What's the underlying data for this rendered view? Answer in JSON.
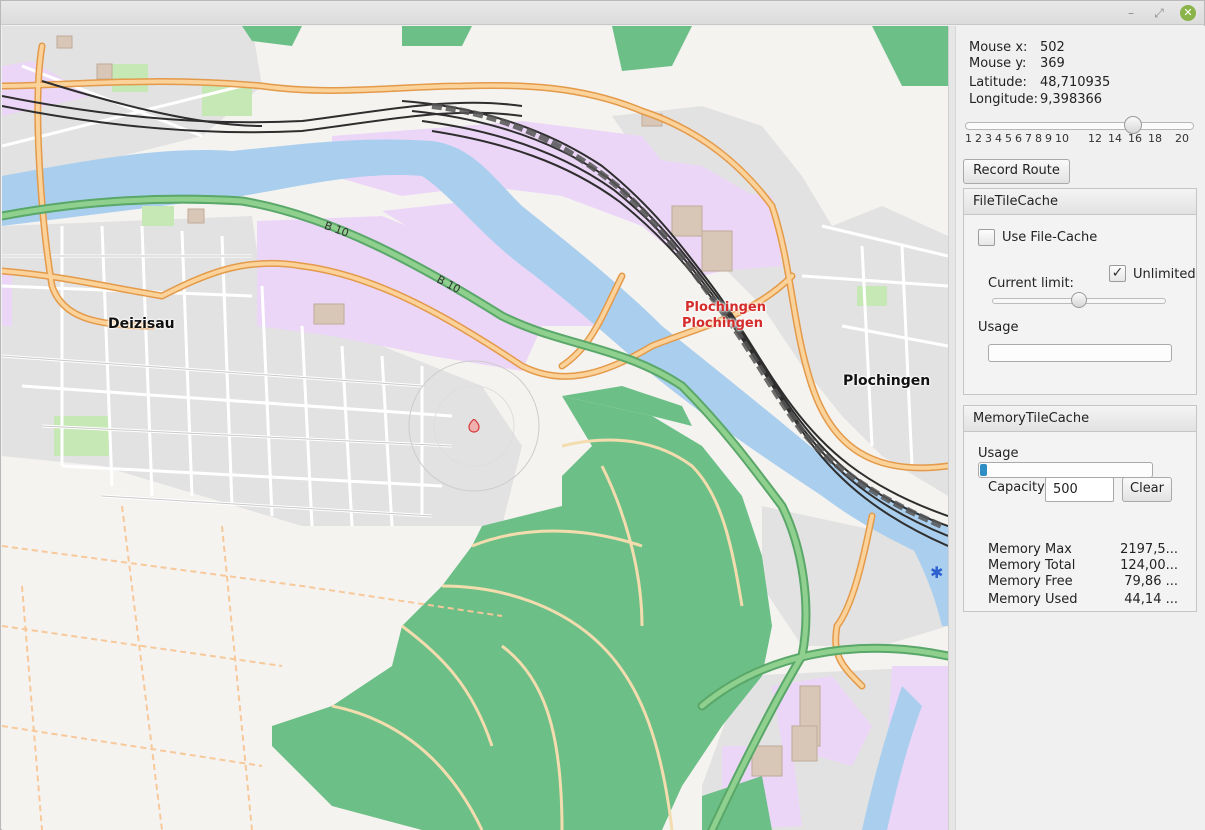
{
  "window": {
    "controls": {
      "minimize": "–",
      "maximize": "⤢",
      "close": "✕"
    }
  },
  "map": {
    "labels": {
      "deizisau": "Deizisau",
      "plochingen_main": "Plochingen",
      "plochingen_red_1": "Plochingen",
      "plochingen_red_2": "Plochingen",
      "b10_a": "B 10",
      "b10_b": "B 10"
    },
    "colors": {
      "forest": "#6dbf88",
      "water": "#aacfee",
      "industrial": "#ead3f5",
      "residential": "#e0e0e0",
      "road_major": "#f4b46a",
      "road_b10": "#7bbd72",
      "rail": "#444444",
      "background": "#f5f3f0"
    }
  },
  "info": {
    "mouse_x_label": "Mouse x:",
    "mouse_x": "502",
    "mouse_y_label": "Mouse y:",
    "mouse_y": "369",
    "lat_label": "Latitude:",
    "lat": "48,710935",
    "lon_label": "Longitude:",
    "lon": "9,398366"
  },
  "zoom": {
    "ticks": [
      "1",
      "2",
      "3",
      "4",
      "5",
      "6",
      "7",
      "8",
      "9",
      "10",
      "12",
      "14",
      "16",
      "18",
      "20"
    ],
    "value": 15
  },
  "record_route_label": "Record Route",
  "file_tile_cache": {
    "title": "FileTileCache",
    "use_file_cache_label": "Use File-Cache",
    "use_file_cache_checked": false,
    "unlimited_label": "Unlimited",
    "unlimited_checked": true,
    "unlimited_check": "✓",
    "current_limit_label": "Current limit:",
    "usage_label": "Usage",
    "usage_fraction": 0
  },
  "memory_tile_cache": {
    "title": "MemoryTileCache",
    "usage_label": "Usage",
    "usage_fraction": 0.04,
    "capacity_label": "Capacity",
    "capacity_value": "500",
    "clear_label": "Clear",
    "stats": [
      {
        "label": "Memory Max",
        "value": "2197,5..."
      },
      {
        "label": "Memory Total",
        "value": "124,00..."
      },
      {
        "label": "Memory Free",
        "value": "79,86 ..."
      },
      {
        "label": "Memory Used",
        "value": "44,14 ..."
      }
    ]
  }
}
